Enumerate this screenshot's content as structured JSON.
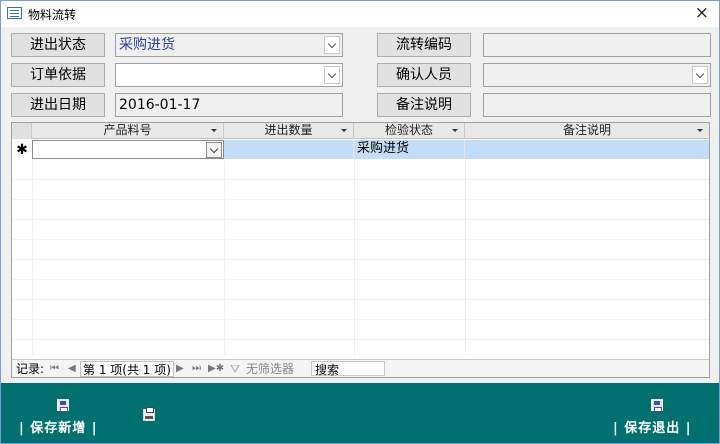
{
  "window": {
    "title": "物料流转",
    "close_glyph": "×"
  },
  "form": {
    "status_label": "进出状态",
    "status_value": "采购进货",
    "order_basis_label": "订单依据",
    "order_basis_value": "",
    "date_label": "进出日期",
    "date_value": "2016-01-17",
    "transfer_code_label": "流转编码",
    "transfer_code_value": "",
    "confirmer_label": "确认人员",
    "confirmer_value": "",
    "remark_label": "备注说明",
    "remark_value": ""
  },
  "grid": {
    "columns": [
      "产品料号",
      "进出数量",
      "检验状态",
      "备注说明"
    ],
    "new_row": {
      "marker": "✱",
      "product_code": "",
      "quantity": "",
      "inspection_status": "采购进货",
      "remark": ""
    }
  },
  "navigator": {
    "record_label": "记录:",
    "first": "⏮",
    "prev": "◀",
    "position": "第 1 项(共 1 项)",
    "next": "▶",
    "last": "⏭",
    "new": "▶✱",
    "filter_label": "无筛选器",
    "search_text": "搜索"
  },
  "footer": {
    "save_add_label": "| 保存新增 |",
    "save_exit_label": "| 保存退出 |"
  },
  "icons": {
    "save": "save-icon",
    "print": "print-icon"
  },
  "colors": {
    "footer_bg": "#007070",
    "selected_cell": "#c3dcf8",
    "status_text": "#2b3e9f"
  }
}
